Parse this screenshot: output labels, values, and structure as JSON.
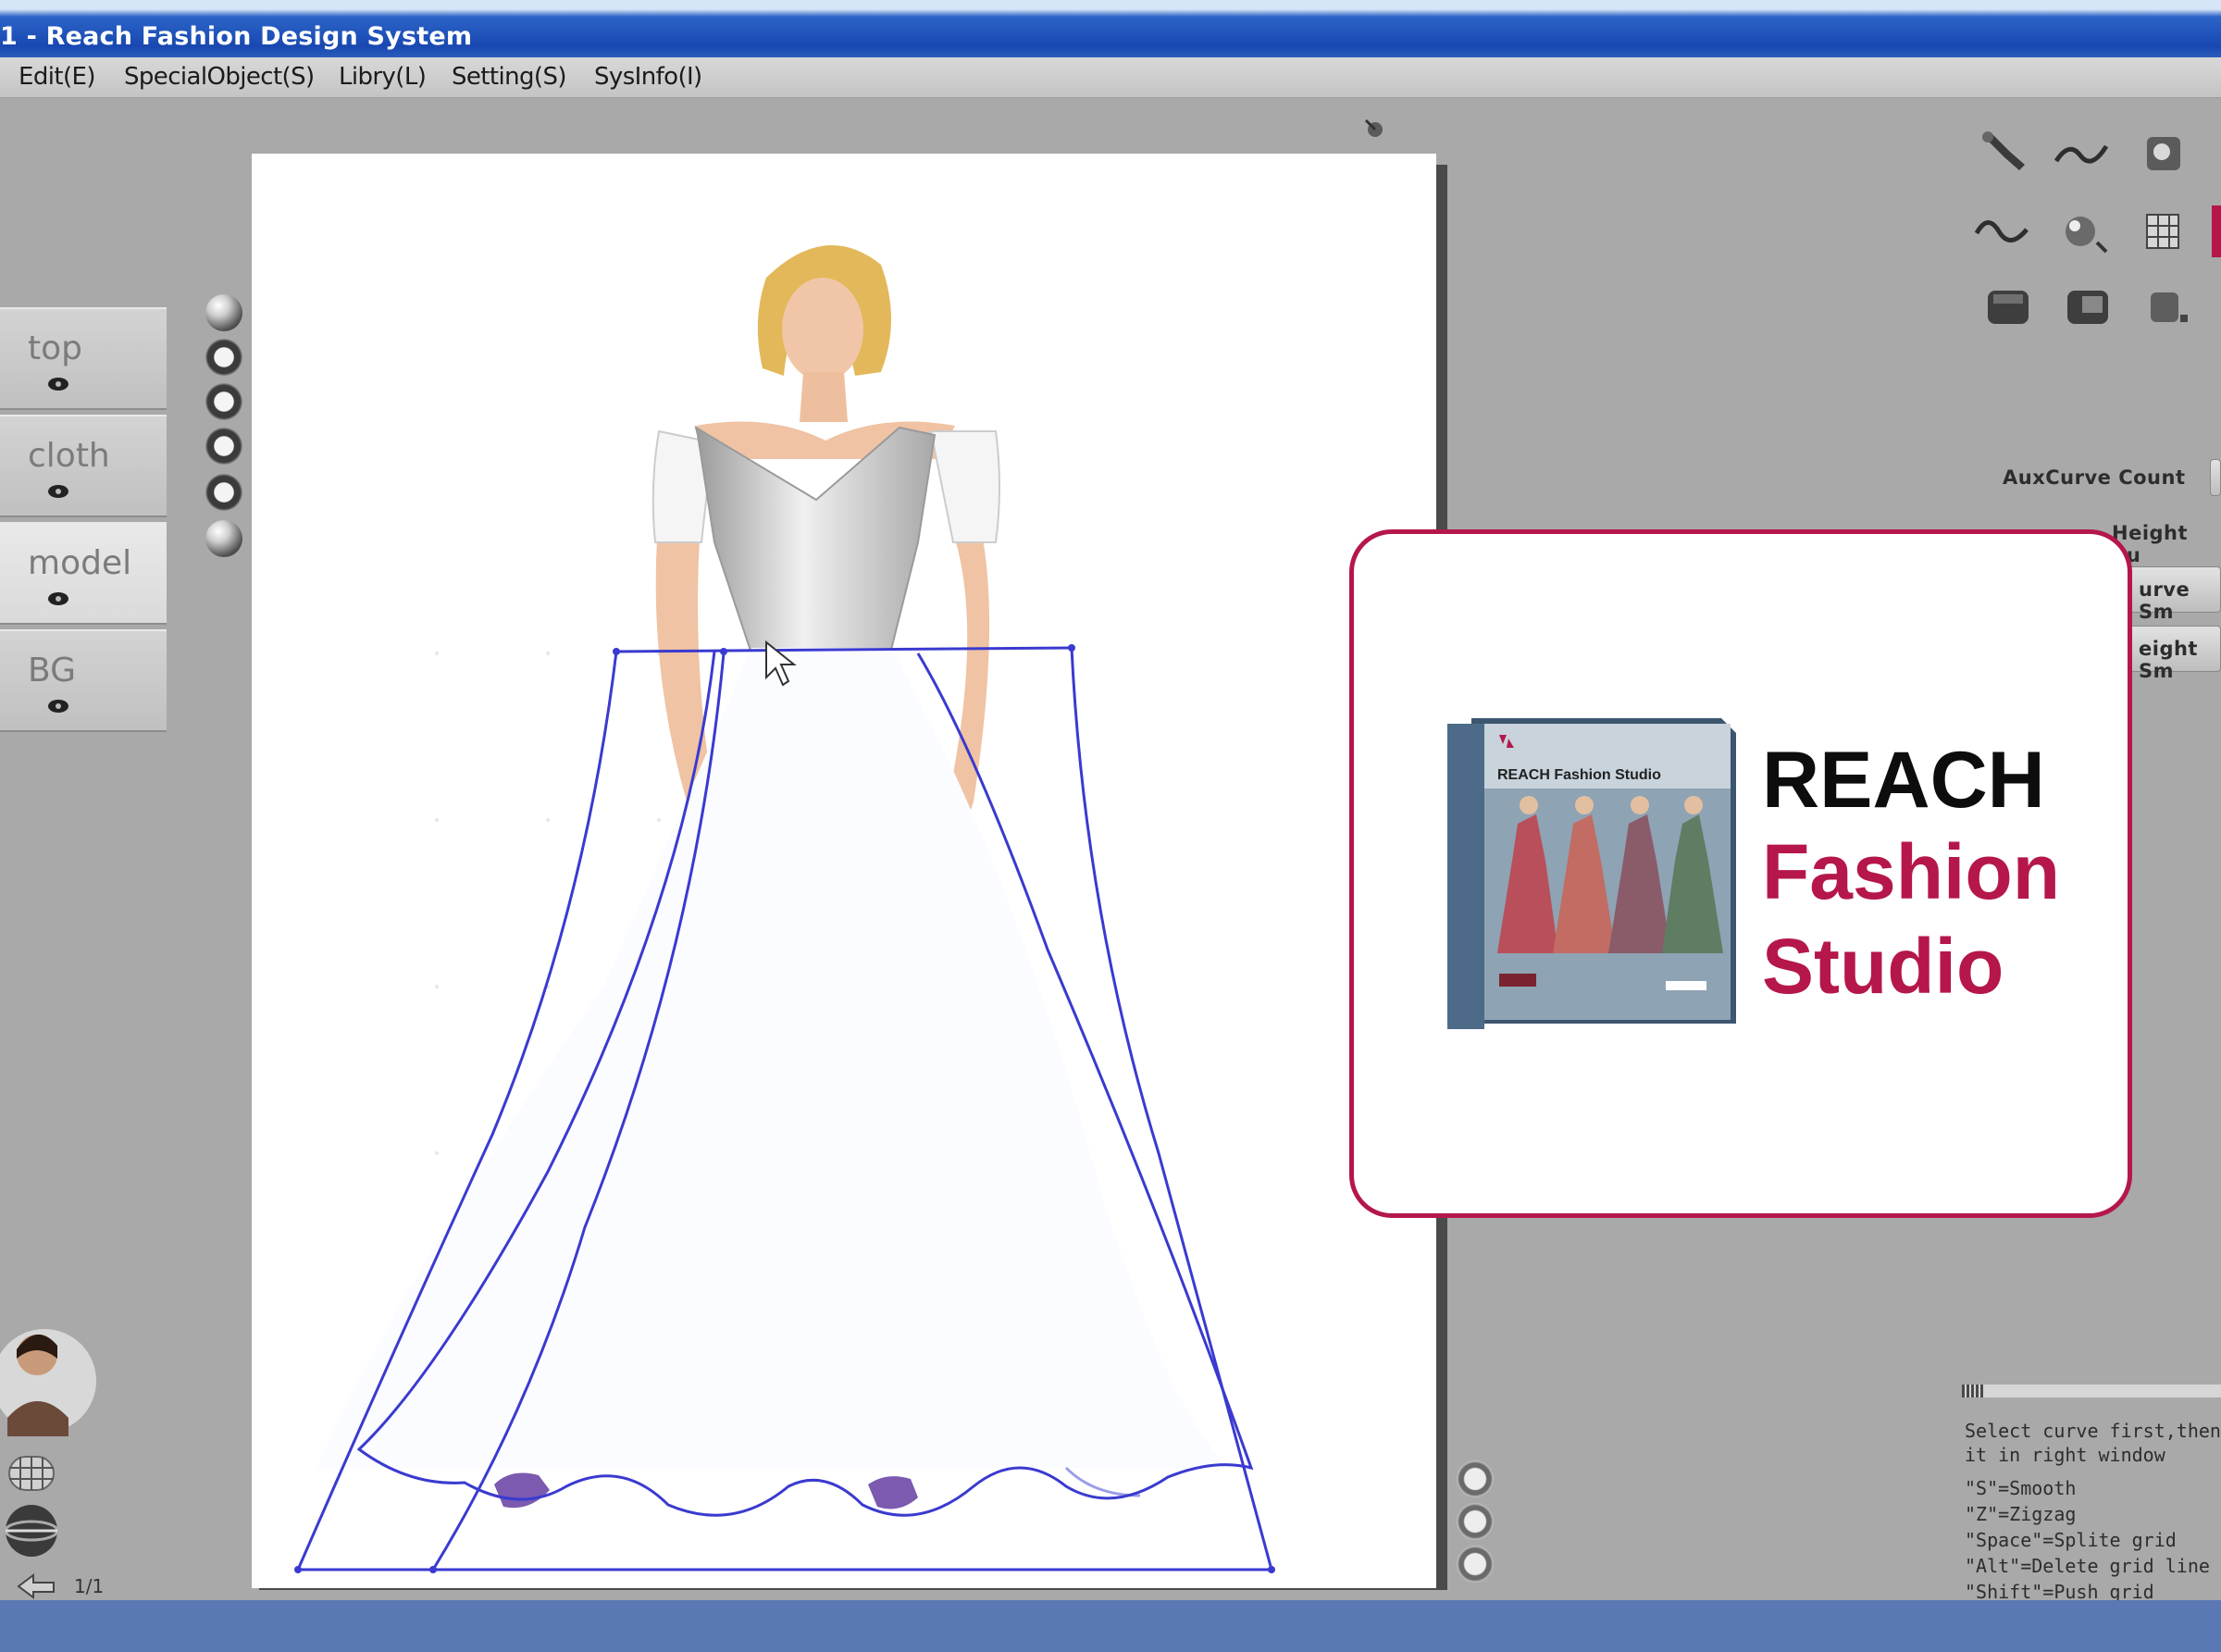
{
  "window": {
    "title": "1 - Reach Fashion Design System"
  },
  "menu": [
    {
      "label": "Edit(E)"
    },
    {
      "label": "SpecialObject(S)"
    },
    {
      "label": "Libry(L)"
    },
    {
      "label": "Setting(S)"
    },
    {
      "label": "SysInfo(I)"
    }
  ],
  "left_tabs": [
    {
      "label": "top",
      "icon": "eye-icon"
    },
    {
      "label": "cloth",
      "icon": "eye-icon"
    },
    {
      "label": "model",
      "icon": "eye-icon"
    },
    {
      "label": "BG",
      "icon": "eye-icon"
    }
  ],
  "right_panel": {
    "auxcurve_label": "AuxCurve Count",
    "height_curve_label": "Height Cu",
    "curve_smooth_label": "urve Sm",
    "height_smooth_label": "eight Sm"
  },
  "help_lines": [
    "Select curve first,then",
    "it in right window",
    "\"S\"=Smooth",
    "\"Z\"=Zigzag",
    "\"Space\"=Splite grid",
    "\"Alt\"=Delete grid line",
    "\"Shift\"=Push grid"
  ],
  "page_indicator": "1/1",
  "popup": {
    "brand_line1": "REACH",
    "brand_line2": "Fashion",
    "brand_line3": "Studio",
    "box_title_small": "REACH Fashion Studio"
  },
  "colors": {
    "brand_accent": "#b5174a",
    "curve_blue": "#3a3ad0",
    "titlebar": "#1848b0",
    "taskbar": "#5a78b3"
  }
}
